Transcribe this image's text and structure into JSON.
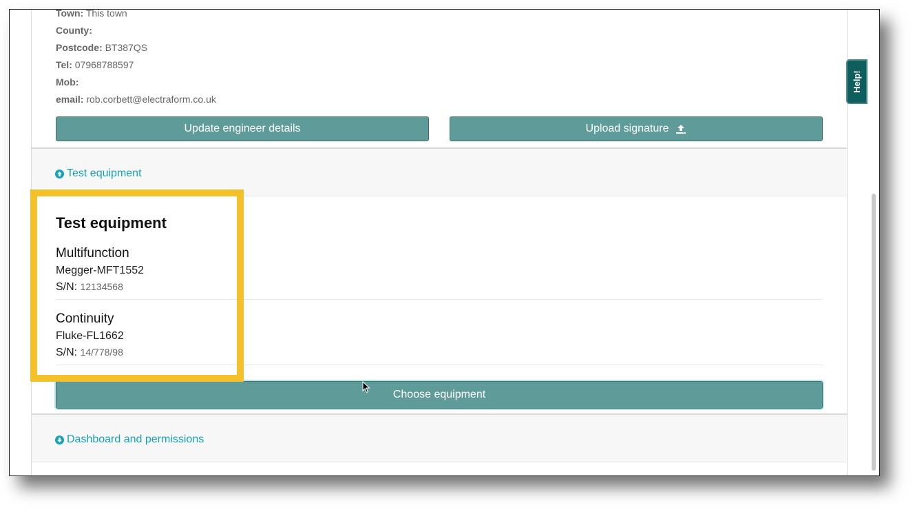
{
  "engineer": {
    "town_label": "Town:",
    "town_value": "This town",
    "county_label": "County:",
    "county_value": "",
    "postcode_label": "Postcode:",
    "postcode_value": "BT387QS",
    "tel_label": "Tel:",
    "tel_value": "07968788597",
    "mob_label": "Mob:",
    "mob_value": "",
    "email_label": "email:",
    "email_value": "rob.corbett@electraform.co.uk",
    "update_button": "Update engineer details",
    "upload_button": "Upload signature"
  },
  "test_equipment_section": {
    "link_label": "Test equipment",
    "card_title": "Test equipment",
    "items": [
      {
        "type": "Multifunction",
        "model": "Megger-MFT1552",
        "sn_label": "S/N:",
        "sn": "12134568"
      },
      {
        "type": "Continuity",
        "model": "Fluke-FL1662",
        "sn_label": "S/N:",
        "sn": "14/778/98"
      }
    ],
    "choose_button": "Choose equipment"
  },
  "dashboard_section": {
    "link_label": "Dashboard and permissions"
  },
  "help_tab": "Help!",
  "colors": {
    "button": "#5f9b99",
    "link": "#17a2b8",
    "highlight": "#f4c12b",
    "help_tab": "#0e5e5d"
  }
}
